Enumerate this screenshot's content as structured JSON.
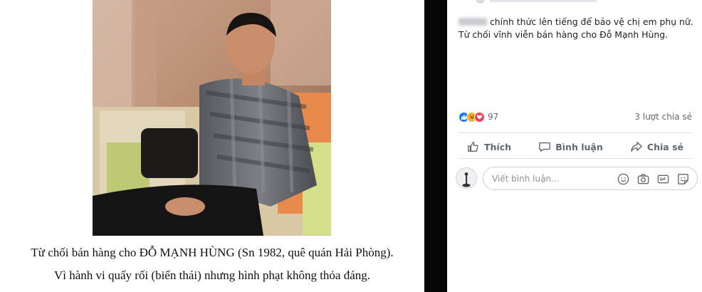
{
  "photo": {
    "alt": "man-seated-on-sofa-photo"
  },
  "caption": {
    "line1": "Từ chối bán hàng cho ĐỖ MẠNH HÙNG (Sn 1982, quê quán Hải Phòng).",
    "line2": "Vì hành vi quấy rối (biến thái) nhưng hình phạt không thỏa đáng."
  },
  "post": {
    "text_line1_suffix": "chính thức lên tiếng để bảo vệ chị em phụ nữ.",
    "text_line2": "Từ chối vĩnh viễn bán hàng cho Đỗ Mạnh Hùng."
  },
  "stats": {
    "reactions": [
      "like-icon",
      "haha-icon",
      "love-icon"
    ],
    "reaction_count": "97",
    "shares": "3 lượt chia sẻ"
  },
  "actions": {
    "like": "Thích",
    "comment": "Bình luận",
    "share": "Chia sẻ"
  },
  "comment": {
    "placeholder": "Viết bình luận..."
  },
  "colors": {
    "fb_blue": "#1877f2",
    "divider": "#050505",
    "text_secondary": "#606770"
  }
}
